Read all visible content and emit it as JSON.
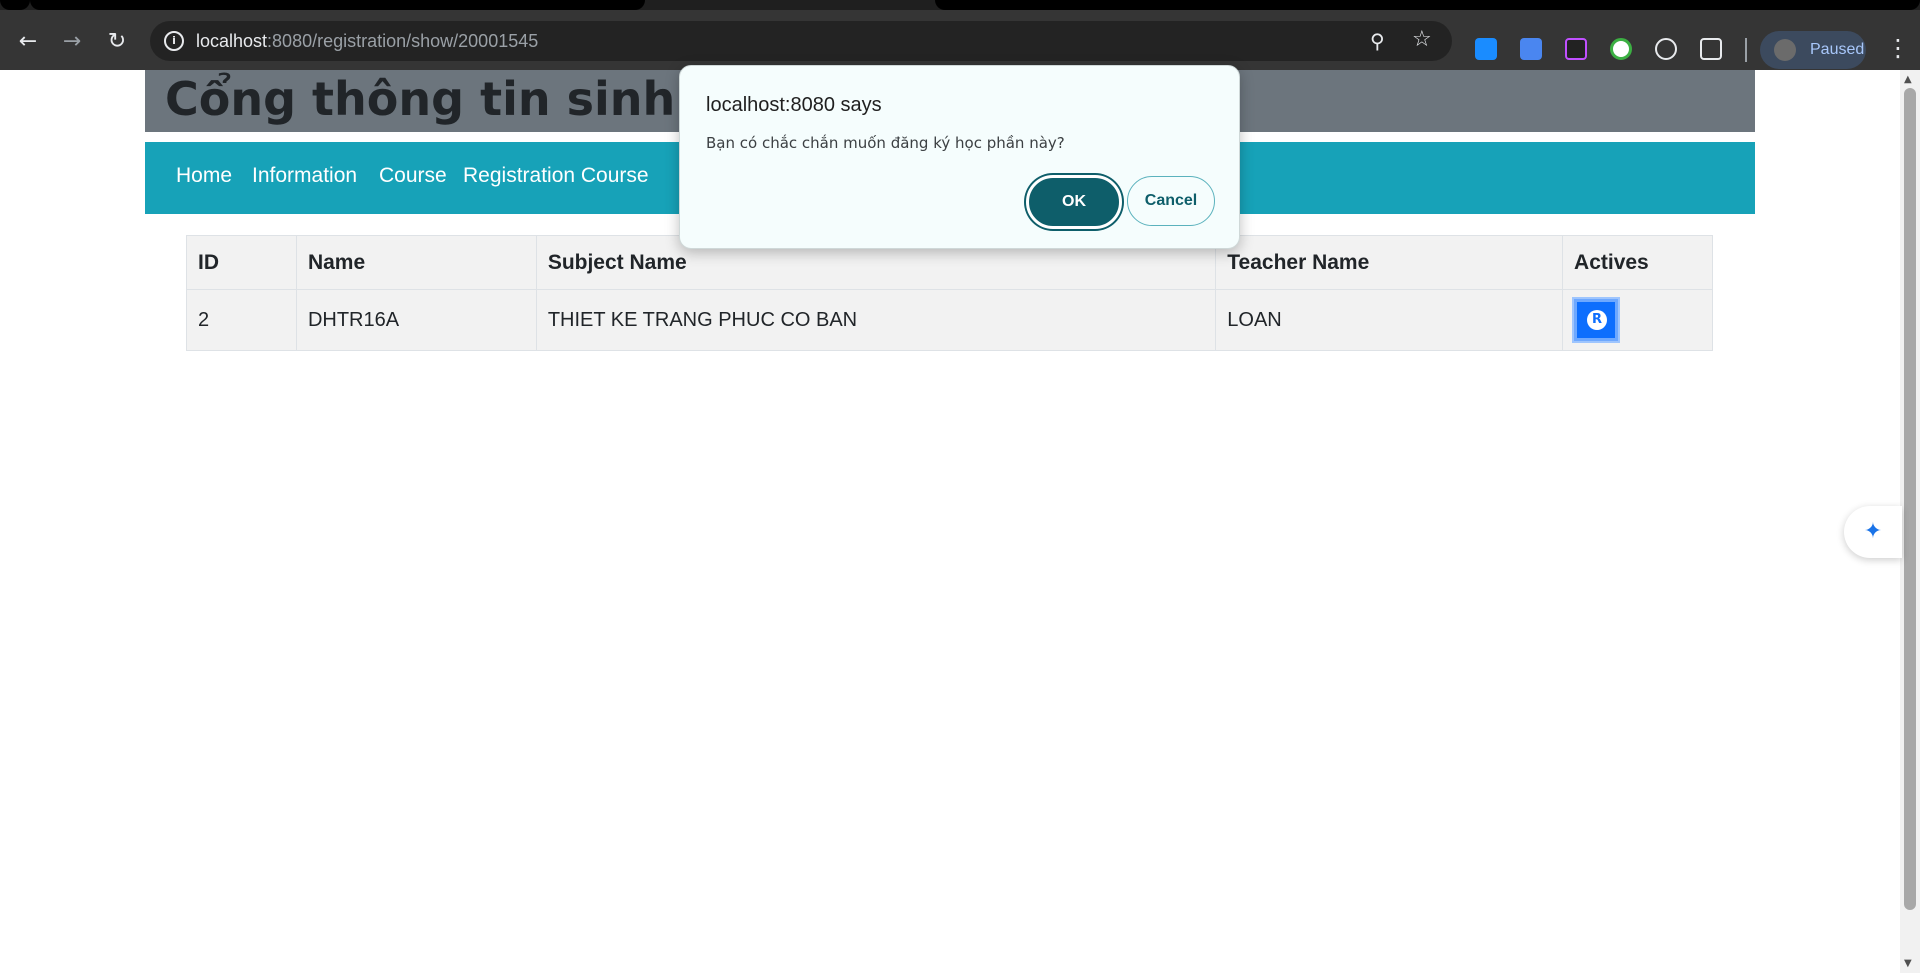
{
  "browser": {
    "url_host": "localhost",
    "url_rest": ":8080/registration/show/20001545",
    "profile_label": "Paused",
    "icons": [
      "back-icon",
      "forward-icon",
      "reload-icon",
      "info-icon",
      "zoom-icon",
      "star-icon",
      "extensions-icon",
      "menu-icon"
    ]
  },
  "page": {
    "banner_title": "Cổng thông tin sinh viên",
    "nav": [
      "Home",
      "Information",
      "Course",
      "Registration Course"
    ]
  },
  "table": {
    "headers": [
      "ID",
      "Name",
      "Subject Name",
      "Teacher Name",
      "Actives"
    ],
    "rows": [
      {
        "id": "2",
        "name": "DHTR16A",
        "subject": "THIET KE TRANG PHUC CO BAN",
        "teacher": "LOAN",
        "action_label": "R"
      }
    ]
  },
  "dialog": {
    "title": "localhost:8080 says",
    "message": "Bạn có chắc chắn muốn đăng ký học phần này?",
    "ok_label": "OK",
    "cancel_label": "Cancel"
  },
  "colors": {
    "navbar": "#17a2b8",
    "banner": "#6c757d",
    "ok_button": "#0e5e6a",
    "action_button": "#0d6efd"
  }
}
